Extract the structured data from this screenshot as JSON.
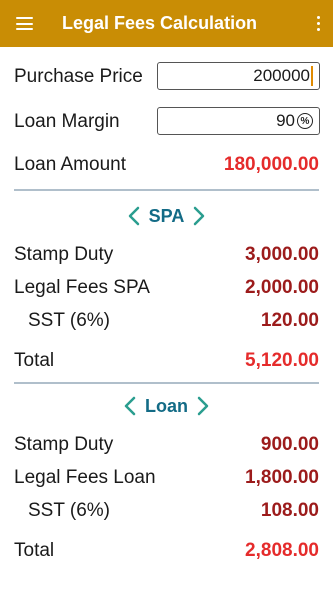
{
  "app": {
    "title": "Legal Fees Calculation"
  },
  "inputs": {
    "purchase_price": {
      "label": "Purchase Price",
      "value": "200000"
    },
    "loan_margin": {
      "label": "Loan Margin",
      "value": "90",
      "unit_icon": "percent-icon"
    }
  },
  "loan_amount": {
    "label": "Loan Amount",
    "value": "180,000.00"
  },
  "spa": {
    "title": "SPA",
    "stamp_duty": {
      "label": "Stamp Duty",
      "value": "3,000.00"
    },
    "legal_fees": {
      "label": "Legal Fees SPA",
      "value": "2,000.00"
    },
    "sst": {
      "label": "SST (6%)",
      "value": "120.00"
    },
    "total": {
      "label": "Total",
      "value": "5,120.00"
    }
  },
  "loan": {
    "title": "Loan",
    "stamp_duty": {
      "label": "Stamp Duty",
      "value": "900.00"
    },
    "legal_fees": {
      "label": "Legal Fees Loan",
      "value": "1,800.00"
    },
    "sst": {
      "label": "SST (6%)",
      "value": "108.00"
    },
    "total": {
      "label": "Total",
      "value": "2,808.00"
    }
  },
  "colors": {
    "appbar": "#c98d05",
    "section_title": "#136b86",
    "value_dark_red": "#9c1b1b",
    "value_bright_red": "#e52b2b"
  }
}
